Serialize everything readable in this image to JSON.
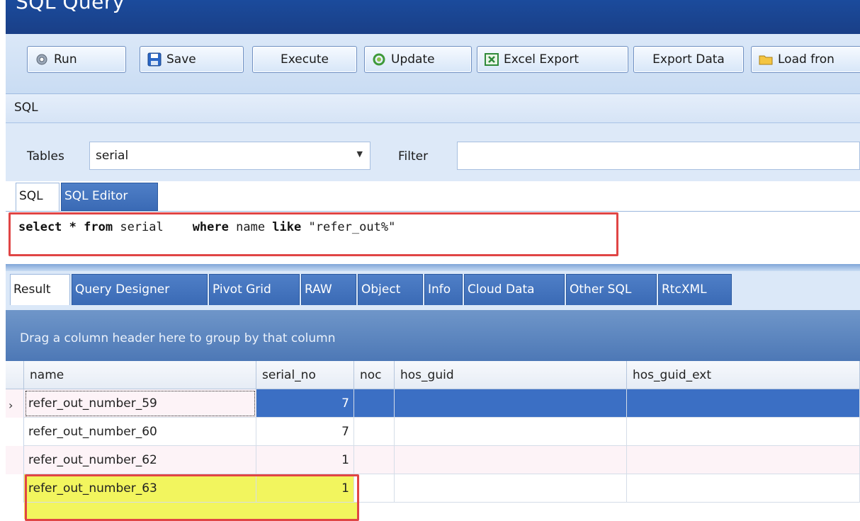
{
  "window": {
    "title": "SQL Query"
  },
  "toolbar": {
    "run": "Run",
    "save": "Save",
    "execute": "Execute",
    "update": "Update",
    "excel_export": "Excel Export",
    "export_data": "Export Data",
    "load_from": "Load fron"
  },
  "sql_group": {
    "label": "SQL"
  },
  "tables": {
    "label": "Tables",
    "value": "serial",
    "filter_label": "Filter",
    "filter_value": ""
  },
  "sql_tabs": [
    "SQL",
    "SQL Editor"
  ],
  "sql_editor": {
    "kw_select": "select",
    "star": " * ",
    "kw_from": "from",
    "table": " serial    ",
    "kw_where": "where",
    "col": " name ",
    "kw_like": "like",
    "literal": " \"refer_out%\""
  },
  "result_tabs": [
    "Result",
    "Query Designer",
    "Pivot Grid",
    "RAW",
    "Object",
    "Info",
    "Cloud Data",
    "Other SQL",
    "RtcXML"
  ],
  "group_panel": {
    "text": "Drag a column header here to group by that column"
  },
  "grid": {
    "columns": [
      "name",
      "serial_no",
      "noc",
      "hos_guid",
      "hos_guid_ext"
    ],
    "rows": [
      {
        "name": "refer_out_number_59",
        "serial_no": "7",
        "noc": "",
        "hos_guid": "",
        "hos_guid_ext": ""
      },
      {
        "name": "refer_out_number_60",
        "serial_no": "7",
        "noc": "",
        "hos_guid": "",
        "hos_guid_ext": ""
      },
      {
        "name": "refer_out_number_62",
        "serial_no": "1",
        "noc": "",
        "hos_guid": "",
        "hos_guid_ext": ""
      },
      {
        "name": "refer_out_number_63",
        "serial_no": "1",
        "noc": "",
        "hos_guid": "",
        "hos_guid_ext": ""
      }
    ]
  },
  "colors": {
    "title_bar": "#1b4b9c",
    "selection": "#3b6fc4",
    "highlight_box": "#e04545",
    "row_highlight": "#f2f55e"
  }
}
